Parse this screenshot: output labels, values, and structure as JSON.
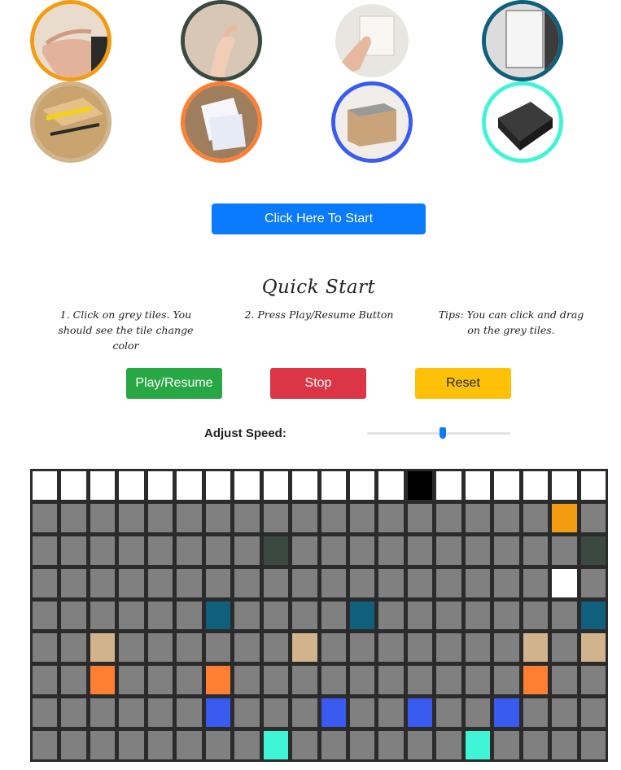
{
  "sounds": [
    {
      "name": "clap",
      "icon": "hand-clap-icon",
      "color": "#f39c12",
      "bg": "#e9dccd"
    },
    {
      "name": "snap",
      "icon": "finger-snap-icon",
      "color": "#3b4a40",
      "bg": "#d9c7b6"
    },
    {
      "name": "switch",
      "icon": "light-switch-icon",
      "color": "#ffffff",
      "bg": "#e8e6e1"
    },
    {
      "name": "door",
      "icon": "door-icon",
      "color": "#0f5f7d",
      "bg": "#dcdcdc"
    },
    {
      "name": "box",
      "icon": "cardboard-box-icon",
      "color": "#d2b48c",
      "bg": "#c9a46e"
    },
    {
      "name": "paper",
      "icon": "paper-sheets-icon",
      "color": "#ff7f32",
      "bg": "#9e7e5c"
    },
    {
      "name": "bin",
      "icon": "trash-bin-icon",
      "color": "#3a5bf0",
      "bg": "#f1eee9"
    },
    {
      "name": "sponge",
      "icon": "sponge-icon",
      "color": "#3ff5d5",
      "bg": "#ffffff"
    }
  ],
  "start_button": "Click Here To Start",
  "quick_start": {
    "title": "Quick Start",
    "step1": "1. Click on grey tiles. You should see the tile change color",
    "step2": "2. Press Play/Resume Button",
    "tips": "Tips: You can click and drag on the grey tiles."
  },
  "controls": {
    "play": "Play/Resume",
    "stop": "Stop",
    "reset": "Reset"
  },
  "speed": {
    "label": "Adjust Speed:",
    "value": 0.53
  },
  "colors": {
    "grey": "#808080",
    "white": "#ffffff",
    "active_step": "#000000",
    "grid_bg": "#2b2b2b"
  },
  "grid": {
    "columns": 20,
    "rows": 9,
    "current_step": 13,
    "active": [
      {
        "row": 1,
        "col": 18,
        "color": "#f39c12"
      },
      {
        "row": 2,
        "col": 8,
        "color": "#3b4a40"
      },
      {
        "row": 2,
        "col": 19,
        "color": "#3b4a40"
      },
      {
        "row": 3,
        "col": 18,
        "color": "#ffffff"
      },
      {
        "row": 4,
        "col": 6,
        "color": "#0f5f7d"
      },
      {
        "row": 4,
        "col": 11,
        "color": "#0f5f7d"
      },
      {
        "row": 4,
        "col": 19,
        "color": "#0f5f7d"
      },
      {
        "row": 5,
        "col": 2,
        "color": "#d2b48c"
      },
      {
        "row": 5,
        "col": 9,
        "color": "#d2b48c"
      },
      {
        "row": 5,
        "col": 17,
        "color": "#d2b48c"
      },
      {
        "row": 5,
        "col": 19,
        "color": "#d2b48c"
      },
      {
        "row": 6,
        "col": 2,
        "color": "#ff7f32"
      },
      {
        "row": 6,
        "col": 6,
        "color": "#ff7f32"
      },
      {
        "row": 6,
        "col": 17,
        "color": "#ff7f32"
      },
      {
        "row": 7,
        "col": 6,
        "color": "#3a5bf0"
      },
      {
        "row": 7,
        "col": 10,
        "color": "#3a5bf0"
      },
      {
        "row": 7,
        "col": 13,
        "color": "#3a5bf0"
      },
      {
        "row": 7,
        "col": 16,
        "color": "#3a5bf0"
      },
      {
        "row": 8,
        "col": 8,
        "color": "#3ff5d5"
      },
      {
        "row": 8,
        "col": 15,
        "color": "#3ff5d5"
      }
    ]
  }
}
